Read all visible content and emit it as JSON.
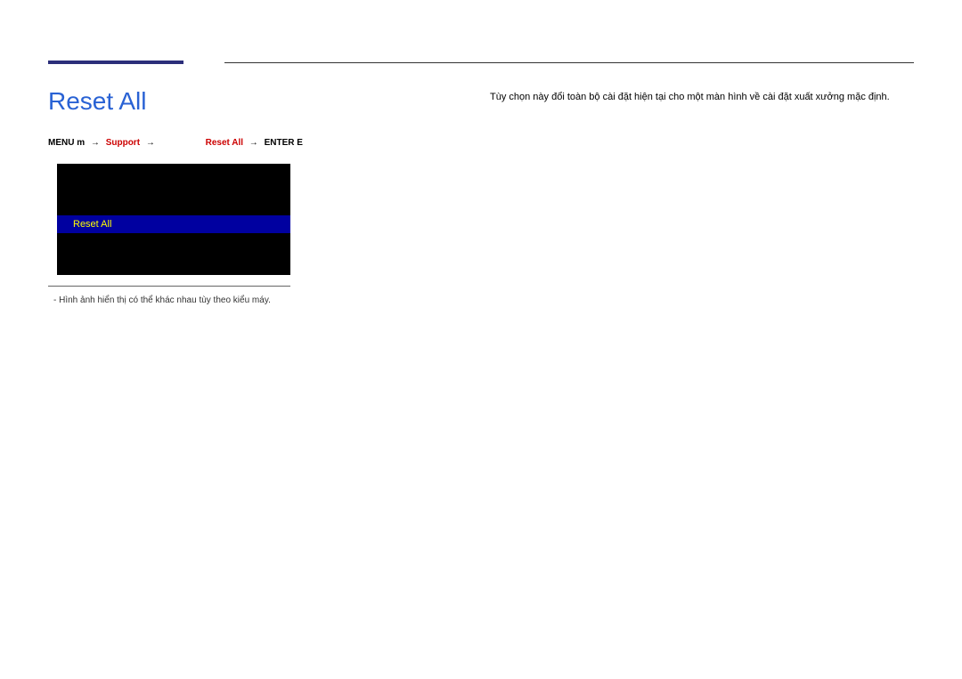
{
  "title": "Reset All",
  "description": "Tùy chọn này đổi toàn bộ cài đặt hiện tại cho một màn hình về cài đặt xuất xưởng mặc định.",
  "breadcrumb": {
    "menu_label": "MENU",
    "menu_glyph": "m",
    "arrow": "→",
    "support": "Support",
    "reset_all": "Reset All",
    "enter": "ENTER",
    "enter_glyph": "E"
  },
  "menu_item": "Reset All",
  "note": "Hình ảnh hiển thị có thể khác nhau tùy theo kiểu máy."
}
